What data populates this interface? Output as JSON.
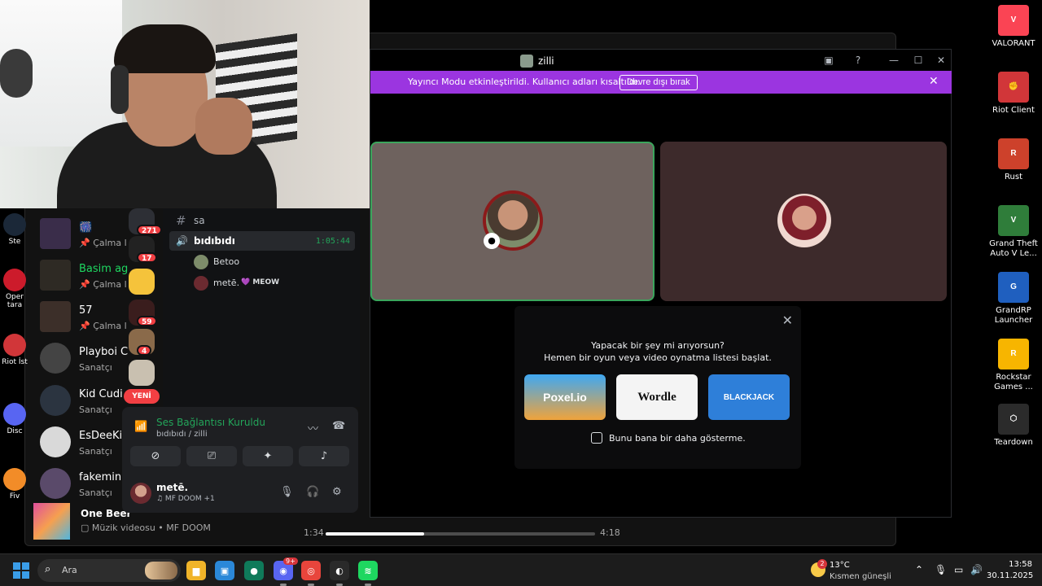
{
  "desktop": {
    "icons": [
      {
        "label": "VALORANT",
        "icon": "valorant-icon",
        "color": "#fa4454",
        "glyph": "V"
      },
      {
        "label": "Riot Client",
        "icon": "riot-client-icon",
        "color": "#d13639",
        "glyph": "✊"
      },
      {
        "label": "Rust",
        "icon": "rust-icon",
        "color": "#cd412b",
        "glyph": "R"
      },
      {
        "label": "Grand Theft Auto V Le...",
        "icon": "gta-icon",
        "color": "#2f7d3a",
        "glyph": "V"
      },
      {
        "label": "GrandRP Launcher",
        "icon": "grandrp-icon",
        "color": "#1f5fbf",
        "glyph": "G"
      },
      {
        "label": "Rockstar Games ...",
        "icon": "rockstar-icon",
        "color": "#f7b500",
        "glyph": "R"
      },
      {
        "label": "Teardown",
        "icon": "teardown-icon",
        "color": "#2b2b2b",
        "glyph": "⬡"
      }
    ],
    "left_icons": [
      {
        "label": "Ste",
        "icon": "steam-icon",
        "color": "#1b2838"
      },
      {
        "label": "Oper tara",
        "icon": "opera-icon",
        "color": "#cc1b2b"
      },
      {
        "label": "Riot İst",
        "icon": "riot-icon",
        "color": "#d13639"
      },
      {
        "label": "Disc",
        "icon": "discord-icon",
        "color": "#5865f2"
      },
      {
        "label": "Fiv",
        "icon": "fivem-icon",
        "color": "#f28c28"
      }
    ]
  },
  "spotify": {
    "list": [
      {
        "title": "🎆",
        "sub": "📌 Çalma l",
        "thumb": "#3a2d4a",
        "round": false
      },
      {
        "title": "Basim ag",
        "sub": "📌 Çalma l",
        "thumb": "#2e2a24",
        "round": false,
        "title_color": "#1ed760"
      },
      {
        "title": "57",
        "sub": "📌 Çalma l",
        "thumb": "#3c2f29",
        "round": false
      },
      {
        "title": "Playboi C",
        "sub": "Sanatçı",
        "thumb": "#444",
        "round": true
      },
      {
        "title": "Kid Cudi",
        "sub": "Sanatçı",
        "thumb": "#2b3440",
        "round": true
      },
      {
        "title": "EsDeeKi",
        "sub": "Sanatçı",
        "thumb": "#d9d9d9",
        "round": true
      },
      {
        "title": "fakemink",
        "sub": "Sanatçı",
        "thumb": "#5a4a6a",
        "round": true
      }
    ],
    "player": {
      "song": "One Beer",
      "meta": "Müzik videosu • MF DOOM",
      "elapsed": "1:34",
      "total": "4:18",
      "progress": 0.366
    }
  },
  "discord": {
    "title": "zilli",
    "streamer": {
      "text": "Yayıncı Modu etkinleştirildi. Kullanıcı adları kısaltıldı.",
      "button": "Devre dışı bırak"
    },
    "activity": {
      "line1": "Yapacak bir şey mi arıyorsun?",
      "line2": "Hemen bir oyun veya video oynatma listesi başlat.",
      "cards": [
        "Poxel.io",
        "Wordle",
        "BLACKJACK"
      ],
      "checkbox": "Bunu bana bir daha gösterme."
    },
    "servers": [
      {
        "badge": "271",
        "color": "#2d2f35"
      },
      {
        "badge": "17",
        "color": "#222"
      },
      {
        "badge": "",
        "color": "#f5c33b"
      },
      {
        "badge": "59",
        "color": "#3a1d1d"
      },
      {
        "badge": "4",
        "color": "#8a6a4a"
      },
      {
        "badge": "",
        "color": "#c9c0b0"
      }
    ],
    "new_label": "YENİ",
    "channel": {
      "text_channel": "sa",
      "voice_channel": "bıdıbıdı",
      "voice_time": "1:05:44",
      "users": [
        {
          "name": "Betoo",
          "tag": "",
          "color": "#7d8c6a"
        },
        {
          "name": "metē.",
          "tag": "💜 MEOW",
          "color": "#6b2a30"
        }
      ]
    },
    "connection": {
      "title": "Ses Bağlantısı Kuruldu",
      "sub": "bıdıbıdı / zilli"
    },
    "user": {
      "name": "metē.",
      "status": "♫ MF DOOM +1"
    }
  },
  "taskbar": {
    "search": "Ara",
    "apps": [
      {
        "icon": "file-explorer-icon",
        "color": "#f0b429",
        "glyph": "▆"
      },
      {
        "icon": "store-icon",
        "color": "#2b88d8",
        "glyph": "▣"
      },
      {
        "icon": "xbox-app-icon",
        "color": "#0f7a5a",
        "glyph": "●"
      },
      {
        "icon": "discord-taskbar-icon",
        "color": "#5865f2",
        "glyph": "◉"
      },
      {
        "icon": "chrome-icon",
        "color": "#e8453c",
        "glyph": "◎"
      },
      {
        "icon": "obs-icon",
        "color": "#2a2a2a",
        "glyph": "◐"
      },
      {
        "icon": "spotify-taskbar-icon",
        "color": "#1ed760",
        "glyph": "≋"
      }
    ],
    "discord_badge": "9+",
    "weather_badge": "2",
    "temp": "13°C",
    "weather": "Kısmen güneşli",
    "time": "13:58",
    "date": "30.11.2025"
  }
}
